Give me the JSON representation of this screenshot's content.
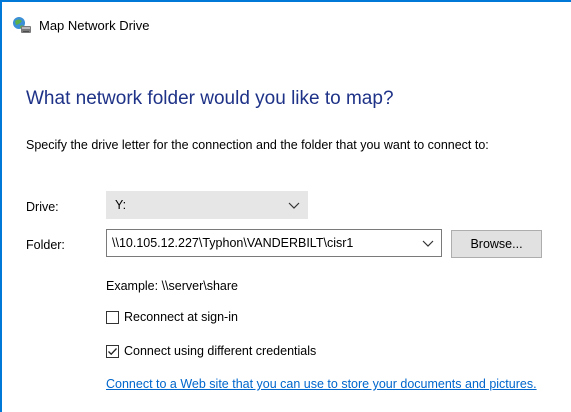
{
  "window": {
    "title": "Map Network Drive",
    "title_icon": "network-drive-icon"
  },
  "main": {
    "heading": "What network folder would you like to map?",
    "instruction": "Specify the drive letter for the connection and the folder that you want to connect to:"
  },
  "drive": {
    "label": "Drive:",
    "value": "Y:"
  },
  "folder": {
    "label": "Folder:",
    "value": "\\\\10.105.12.227\\Typhon\\VANDERBILT\\cisr1",
    "browse_label": "Browse...",
    "example": "Example: \\\\server\\share"
  },
  "options": {
    "reconnect": {
      "label": "Reconnect at sign-in",
      "checked": false
    },
    "credentials": {
      "label": "Connect using different credentials",
      "checked": true
    }
  },
  "link": {
    "text": "Connect to a Web site that you can use to store your documents and pictures."
  },
  "colors": {
    "accent": "#0078d7",
    "heading": "#1e3287",
    "link": "#0066cc"
  }
}
